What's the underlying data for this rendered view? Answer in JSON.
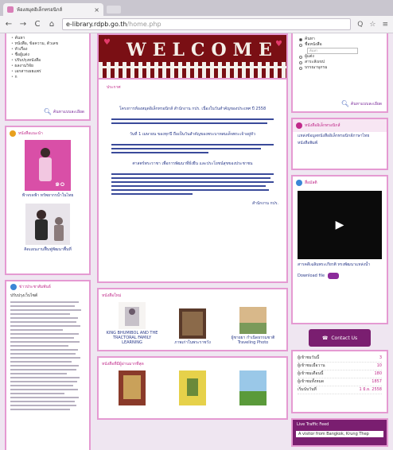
{
  "browser": {
    "tab_title": "ห้องสมุดอิเล็กทรอนิกส์",
    "url_host": "e-library.rdpb.go.th",
    "url_path": "/home.php"
  },
  "left": {
    "categories": [
      "ค้นหา",
      "หนังสือ, ข้อความ, ตัวเลข",
      "หัวเรื่อง",
      "ชื่อผู้แต่ง",
      "ปรับปรุงหนังสือ",
      "ผลงานวิจัย",
      "เอกสารเผยแพร่",
      "ก"
    ],
    "search_link": "ค้นหาแบบละเอียด",
    "recommended_heading": "หนังสือแนะนำ",
    "recommended_books": [
      {
        "caption": "ฟ้าจรดฟ้า ทรัพยากรน้ำในไทย"
      },
      {
        "caption": "คิดเเผนงานฟื้นฟูพัฒนาพื้นที่"
      }
    ],
    "news_heading": "ข่าวประชาสัมพันธ์",
    "news_sub": "ปรับปรุงเว็บไซต์"
  },
  "center": {
    "banner_text": "WELCOME",
    "announce_label": "ประกาศ",
    "paragraphs": [
      "โครงการห้องสมุดอิเล็กทรอนิกส์ สำนักงาน กปร. เนื่องในวันสำคัญของประเทศ ปี 2558",
      "วันที่ 1 เมษายน ของทุกปี ถือเป็นวันสำคัญของพระบาทสมเด็จพระเจ้าอยู่หัว",
      "ศาสตร์พระราชา เพื่อการพัฒนาที่ยั่งยืน และประโยชน์สุขของประชาชน"
    ],
    "sign": "สำนักงาน กปร.",
    "new_books_label": "หนังสือใหม่",
    "new_books": [
      {
        "caption": "KING BHUMIBOL AND THE TRACTORAL FAMILY LEARNING"
      },
      {
        "caption": "ภาพเก่าในพระราชวัง"
      },
      {
        "caption": "ผู้ชายยา กำเนิดธรรมชาติ Traveling Photo"
      }
    ],
    "popular_label": "หนังสือที่มีผู้อ่านมากที่สุด"
  },
  "right": {
    "search_options": [
      "ค้นหา",
      "ชื่อหนังสือ",
      "ผู้แต่ง",
      "สาระสังเขป",
      "บรรณานุกรม"
    ],
    "search_placeholder": "ค้นหา",
    "search_link": "ค้นหาแบบละเอียด",
    "ebooks_heading": "หนังสืออิเล็กทรอนิกส์",
    "ebooks_items": [
      "แหล่งข้อมูลหนังสืออิเล็กทรอนิกส์ภาษาไทย",
      "หนังสือพิมพ์"
    ],
    "media_heading": "สื่อมัลติ",
    "media_caption": "สารคดีเฉลิมพระเกียรติ ทรงพัฒนาแหล่งน้ำ",
    "download_label": "Download file",
    "contact_label": "Contact Us",
    "stats": [
      {
        "label": "ผู้เข้าชมวันนี้",
        "value": "3"
      },
      {
        "label": "ผู้เข้าชมเมื่อวาน",
        "value": "10"
      },
      {
        "label": "ผู้เข้าชมเดือนนี้",
        "value": "180"
      },
      {
        "label": "ผู้เข้าชมทั้งหมด",
        "value": "1857"
      },
      {
        "label": "เริ่มนับวันที่",
        "value": "1 มิ.ย. 2558"
      }
    ],
    "traffic_heading": "Live Traffic Feed",
    "traffic_entry": "A visitor from Bangkok, Krung Thep"
  }
}
